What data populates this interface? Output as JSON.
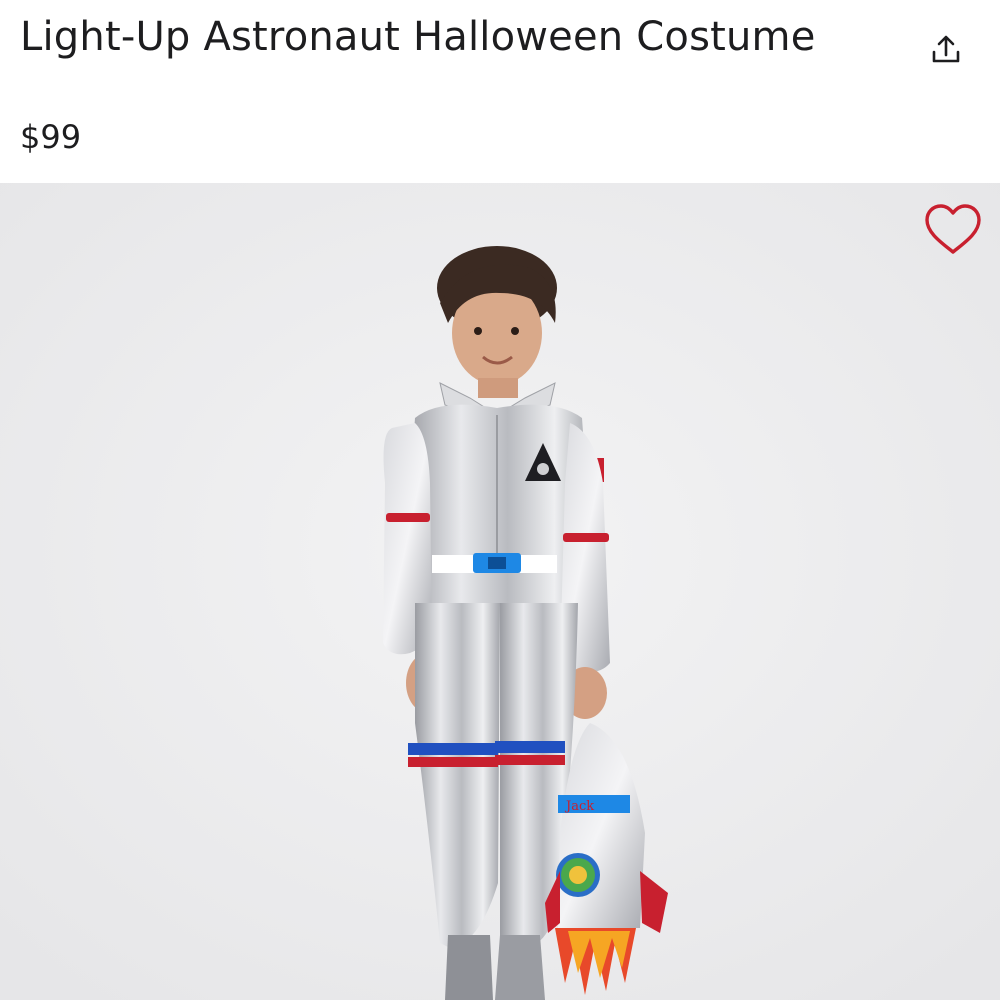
{
  "product": {
    "title": "Light-Up Astronaut Halloween Costume",
    "price": "$99"
  },
  "image": {
    "alt": "Child wearing a silver astronaut costume holding a rocket treat bag",
    "bag_name": "Jack"
  },
  "icons": {
    "share": "share-icon",
    "favorite": "heart-icon"
  },
  "colors": {
    "text": "#1d1d1f",
    "heart": "#c8202f",
    "background": "#efeff0"
  }
}
